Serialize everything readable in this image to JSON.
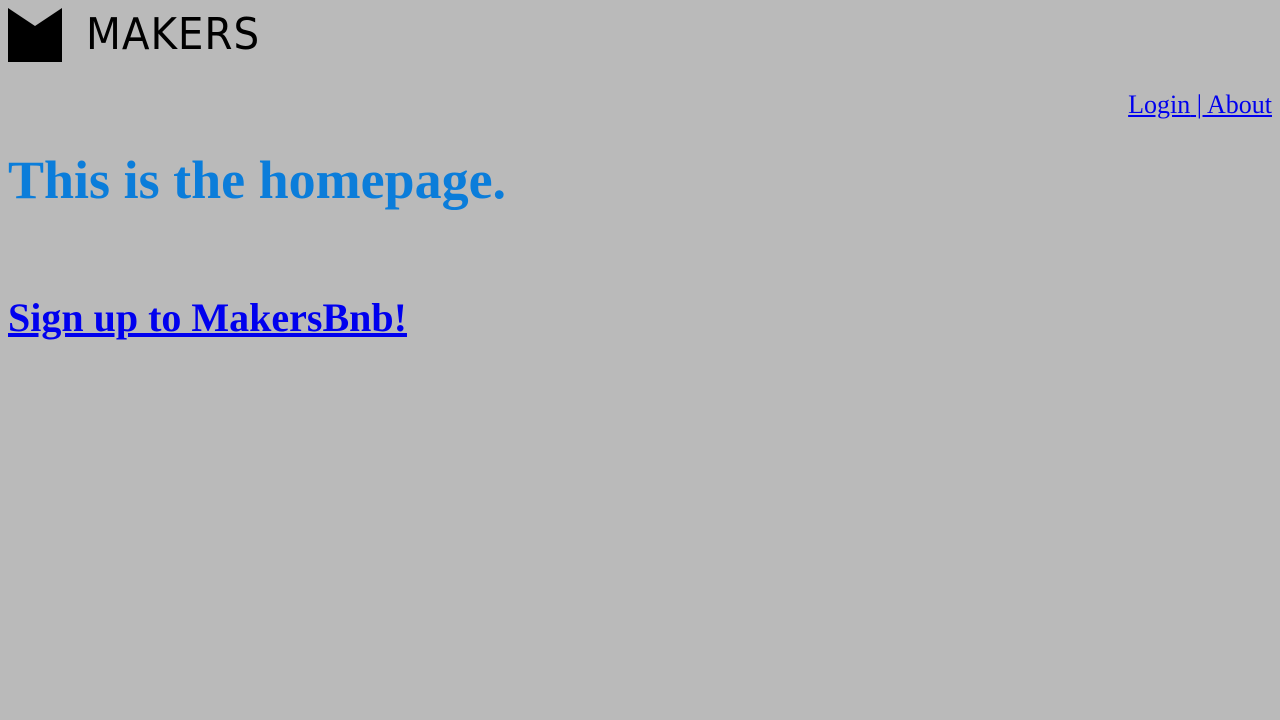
{
  "colors": {
    "background": "#bababa",
    "heading": "#0b7dda",
    "link": "#0000ee",
    "logo": "#000000"
  },
  "header": {
    "logo": {
      "icon": "makers-logo-icon",
      "wordmark": "MAKERS"
    }
  },
  "nav": {
    "login_label": "Login",
    "separator": " | ",
    "about_label": "About"
  },
  "main": {
    "title": "This is the homepage.",
    "signup_label": "Sign up to MakersBnb!"
  }
}
